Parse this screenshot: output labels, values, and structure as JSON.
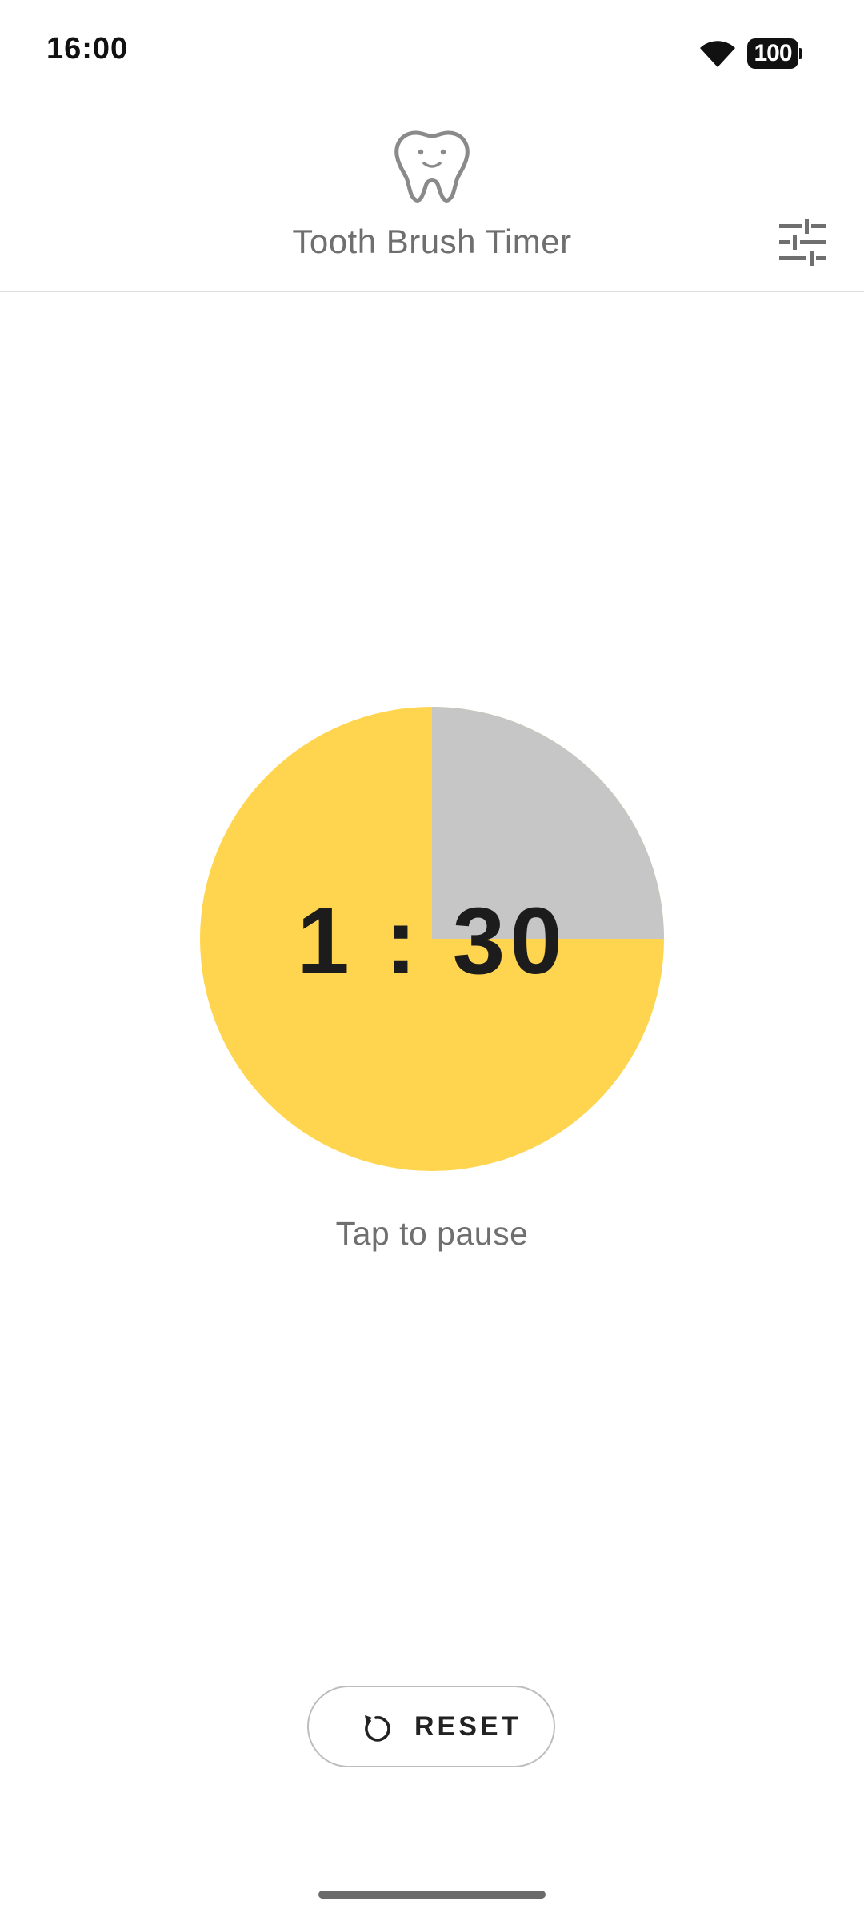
{
  "status_bar": {
    "time": "16:00",
    "battery": "100"
  },
  "header": {
    "title": "Tooth Brush Timer",
    "logo_icon": "tooth-icon",
    "settings_icon": "sliders-icon"
  },
  "timer": {
    "display": "1 : 30",
    "remaining_fraction": 0.25,
    "elapsed_color": "#FFD54F",
    "remaining_color": "#C6C6C6",
    "hint": "Tap to pause"
  },
  "controls": {
    "reset_label": "RESET",
    "reset_icon": "reset-icon"
  },
  "colors": {
    "text_primary": "#1c1c1c",
    "text_secondary": "#6f6f6f",
    "divider": "#dddddd"
  }
}
